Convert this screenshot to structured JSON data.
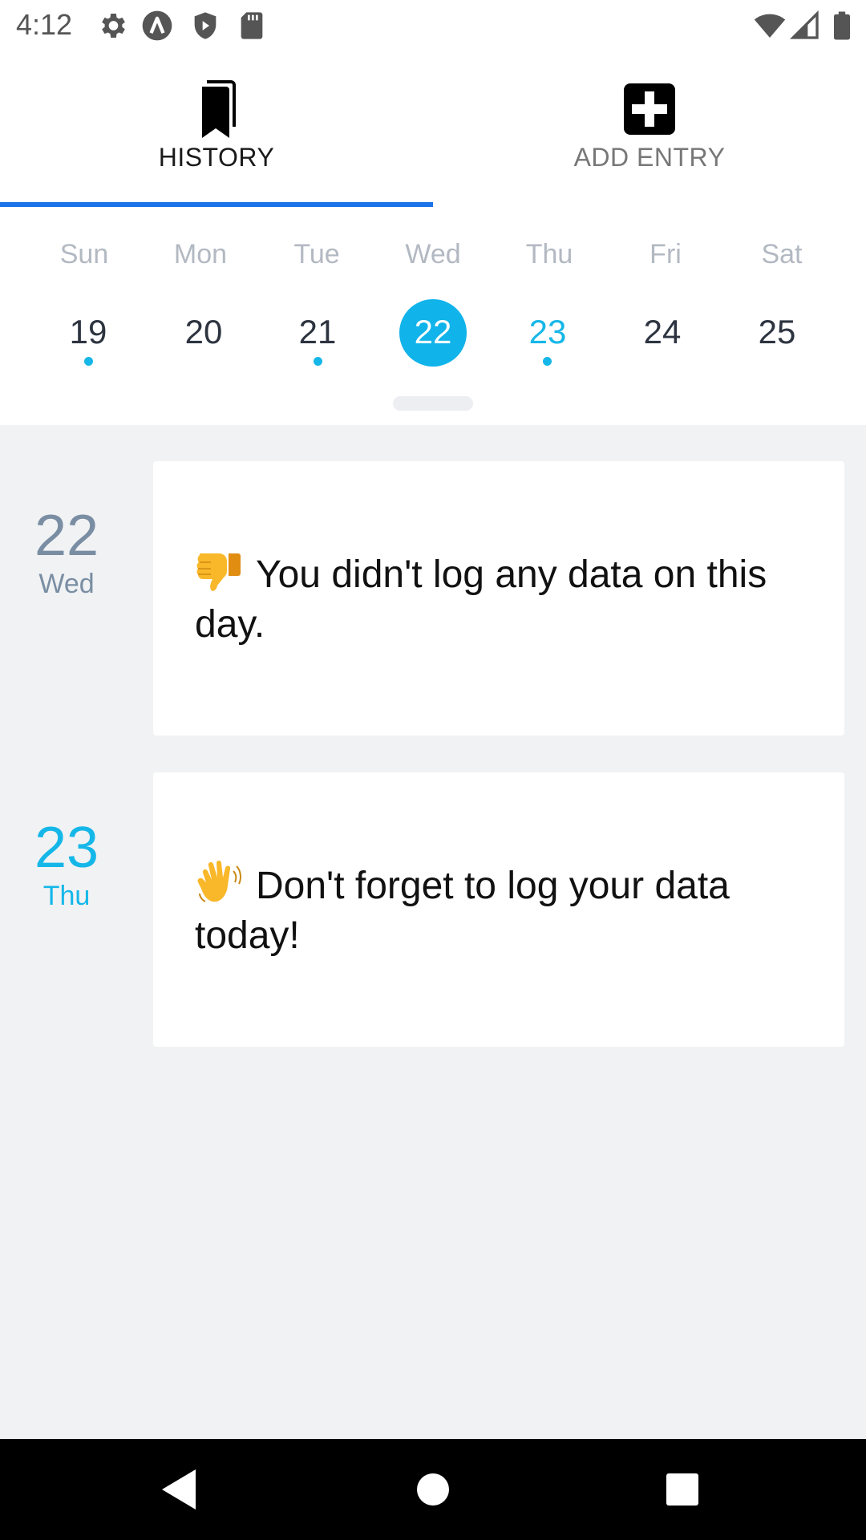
{
  "status_bar": {
    "time": "4:12",
    "left_icons": [
      "gear-icon",
      "a-circle-icon",
      "shield-play-icon",
      "sd-card-icon"
    ],
    "right_icons": [
      "wifi-icon",
      "cell-signal-icon",
      "battery-icon"
    ]
  },
  "tabs": [
    {
      "label": "HISTORY",
      "icon": "bookmark-icon",
      "active": true
    },
    {
      "label": "ADD ENTRY",
      "icon": "add-box-icon",
      "active": false
    }
  ],
  "calendar": {
    "weekdays": [
      "Sun",
      "Mon",
      "Tue",
      "Wed",
      "Thu",
      "Fri",
      "Sat"
    ],
    "days": [
      "19",
      "20",
      "21",
      "22",
      "23",
      "24",
      "25"
    ],
    "selected_day": "22",
    "today": "23",
    "days_with_dots": [
      "19",
      "21",
      "23"
    ]
  },
  "entries": [
    {
      "day": "22",
      "weekday": "Wed",
      "emoji": "thumbs-down-icon",
      "message": "You didn't log any data on this day."
    },
    {
      "day": "23",
      "weekday": "Thu",
      "emoji": "waving-hand-icon",
      "message": "Don't forget to log your data today!"
    }
  ],
  "navigation": {
    "buttons": [
      "back-icon",
      "home-icon",
      "recents-icon"
    ]
  },
  "colors": {
    "accent": "#15b7e8",
    "tab_indicator": "#1a73e8",
    "background": "#f1f2f4",
    "past_date": "#7a8ea3"
  }
}
